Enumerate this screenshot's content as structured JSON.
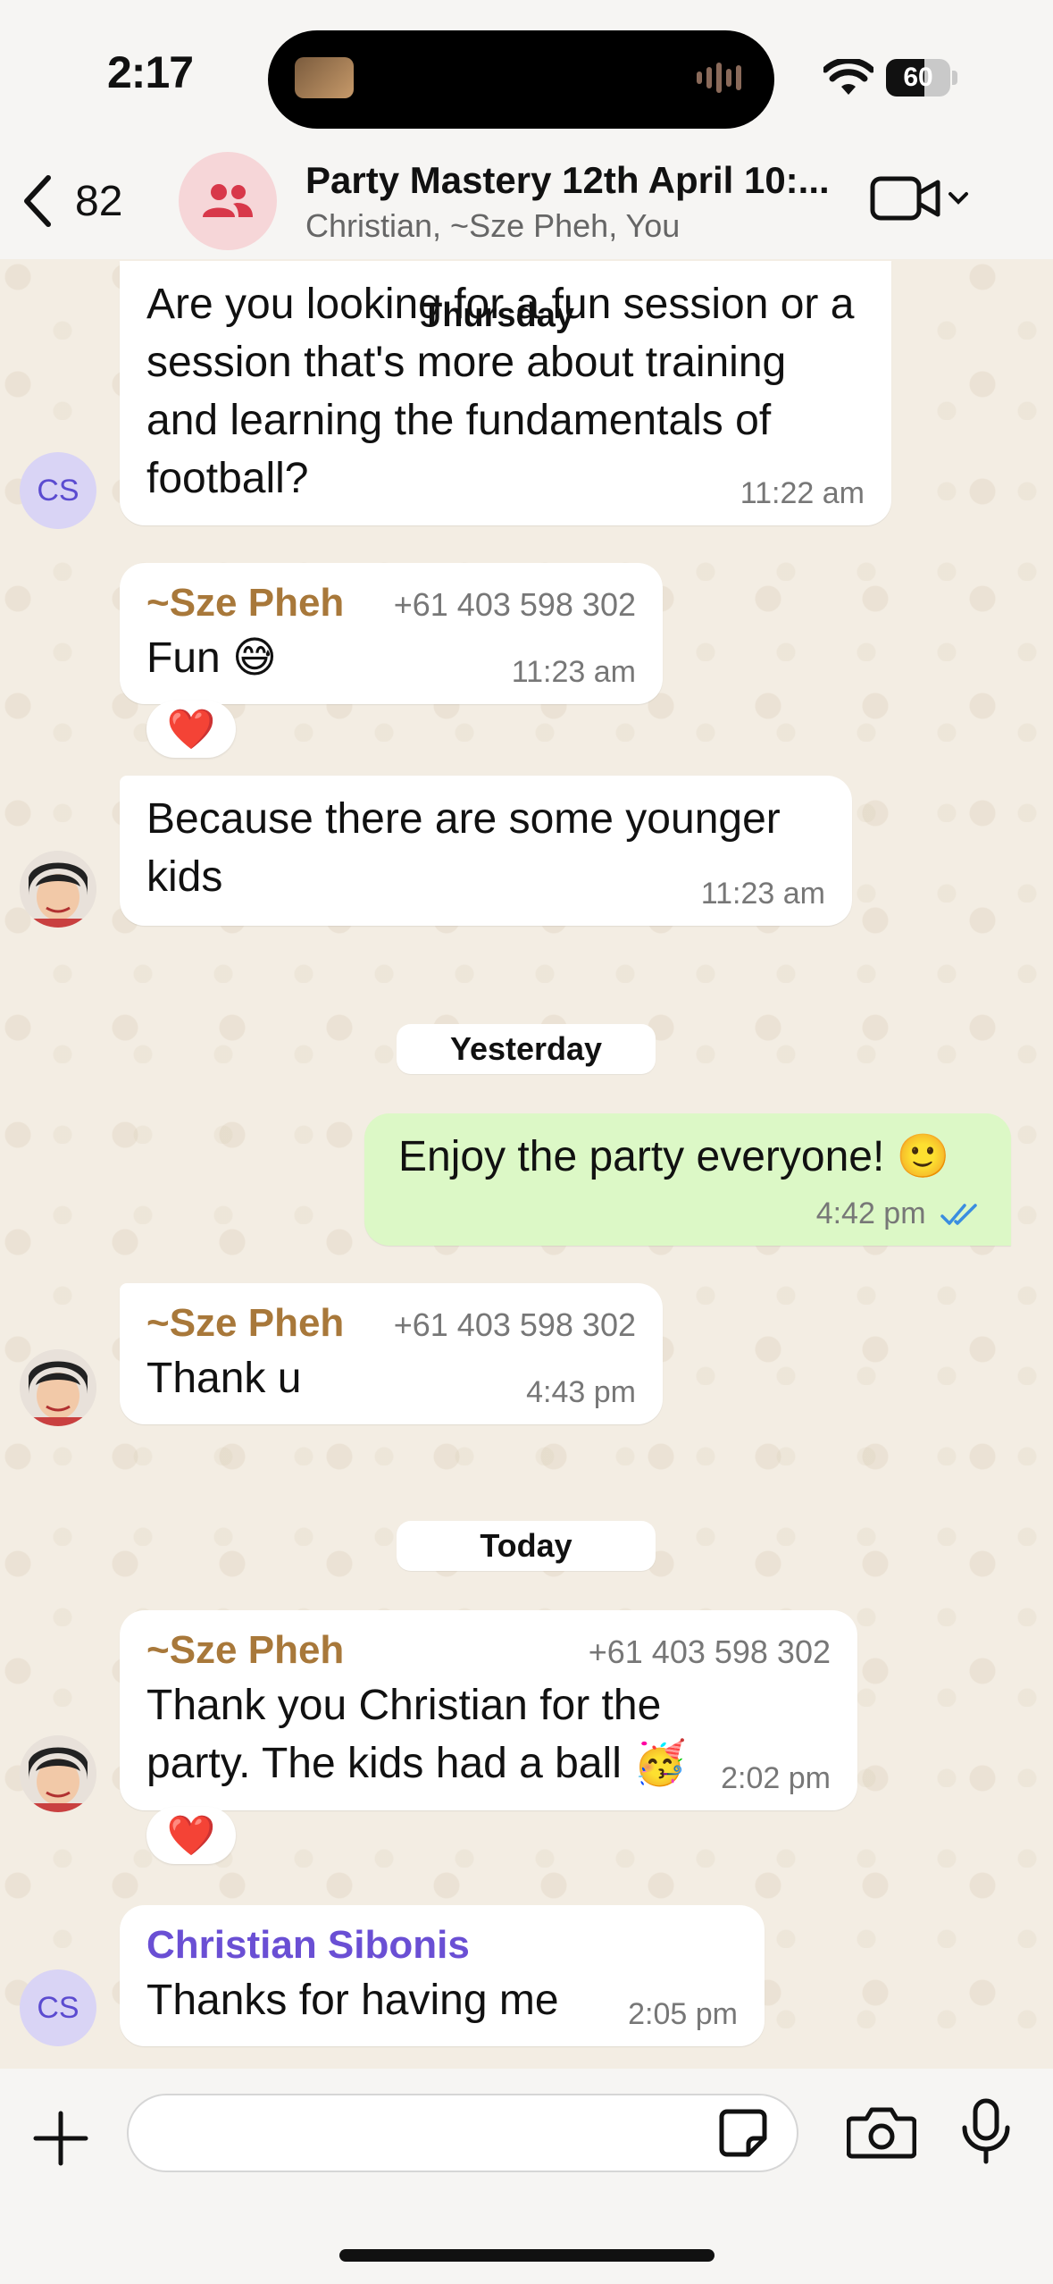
{
  "status_bar": {
    "time": "2:17",
    "battery": "60",
    "battery_level": 0.6
  },
  "header": {
    "back_count": "82",
    "title": "Party Mastery 12th April 10:...",
    "subtitle": "Christian, ~Sze Pheh, You"
  },
  "floating_date": "Thursday",
  "messages": [
    {
      "text": "Are you looking for a fun session or a session that's more about training and learning the fundamentals of football?",
      "time": "11:22 am",
      "avatar": "CS"
    },
    {
      "sender": "~Sze Pheh",
      "phone": "+61 403 598 302",
      "text": "Fun 😅",
      "time": "11:23 am",
      "reaction": "❤️"
    },
    {
      "text": "Because there are some younger kids",
      "time": "11:23 am"
    },
    {
      "date_chip": "Yesterday"
    },
    {
      "text": "Enjoy the party everyone! 🙂",
      "time": "4:42 pm",
      "outgoing": true
    },
    {
      "sender": "~Sze Pheh",
      "phone": "+61 403 598 302",
      "text": "Thank u",
      "time": "4:43 pm"
    },
    {
      "date_chip": "Today"
    },
    {
      "sender": "~Sze Pheh",
      "phone": "+61 403 598 302",
      "text": "Thank you Christian for the party. The kids had a ball 🥳",
      "time": "2:02 pm",
      "reaction": "❤️"
    },
    {
      "sender": "Christian Sibonis",
      "text": "Thanks for having me",
      "time": "2:05 pm",
      "avatar": "CS"
    }
  ],
  "date_chips": {
    "yesterday": "Yesterday",
    "today": "Today"
  },
  "colors": {
    "sze_pheh": "#a8783a",
    "christian": "#6a4fd4",
    "outgoing_bubble": "#dcf8c6",
    "read_ticks": "#3a8de0"
  },
  "input": {
    "placeholder": ""
  }
}
